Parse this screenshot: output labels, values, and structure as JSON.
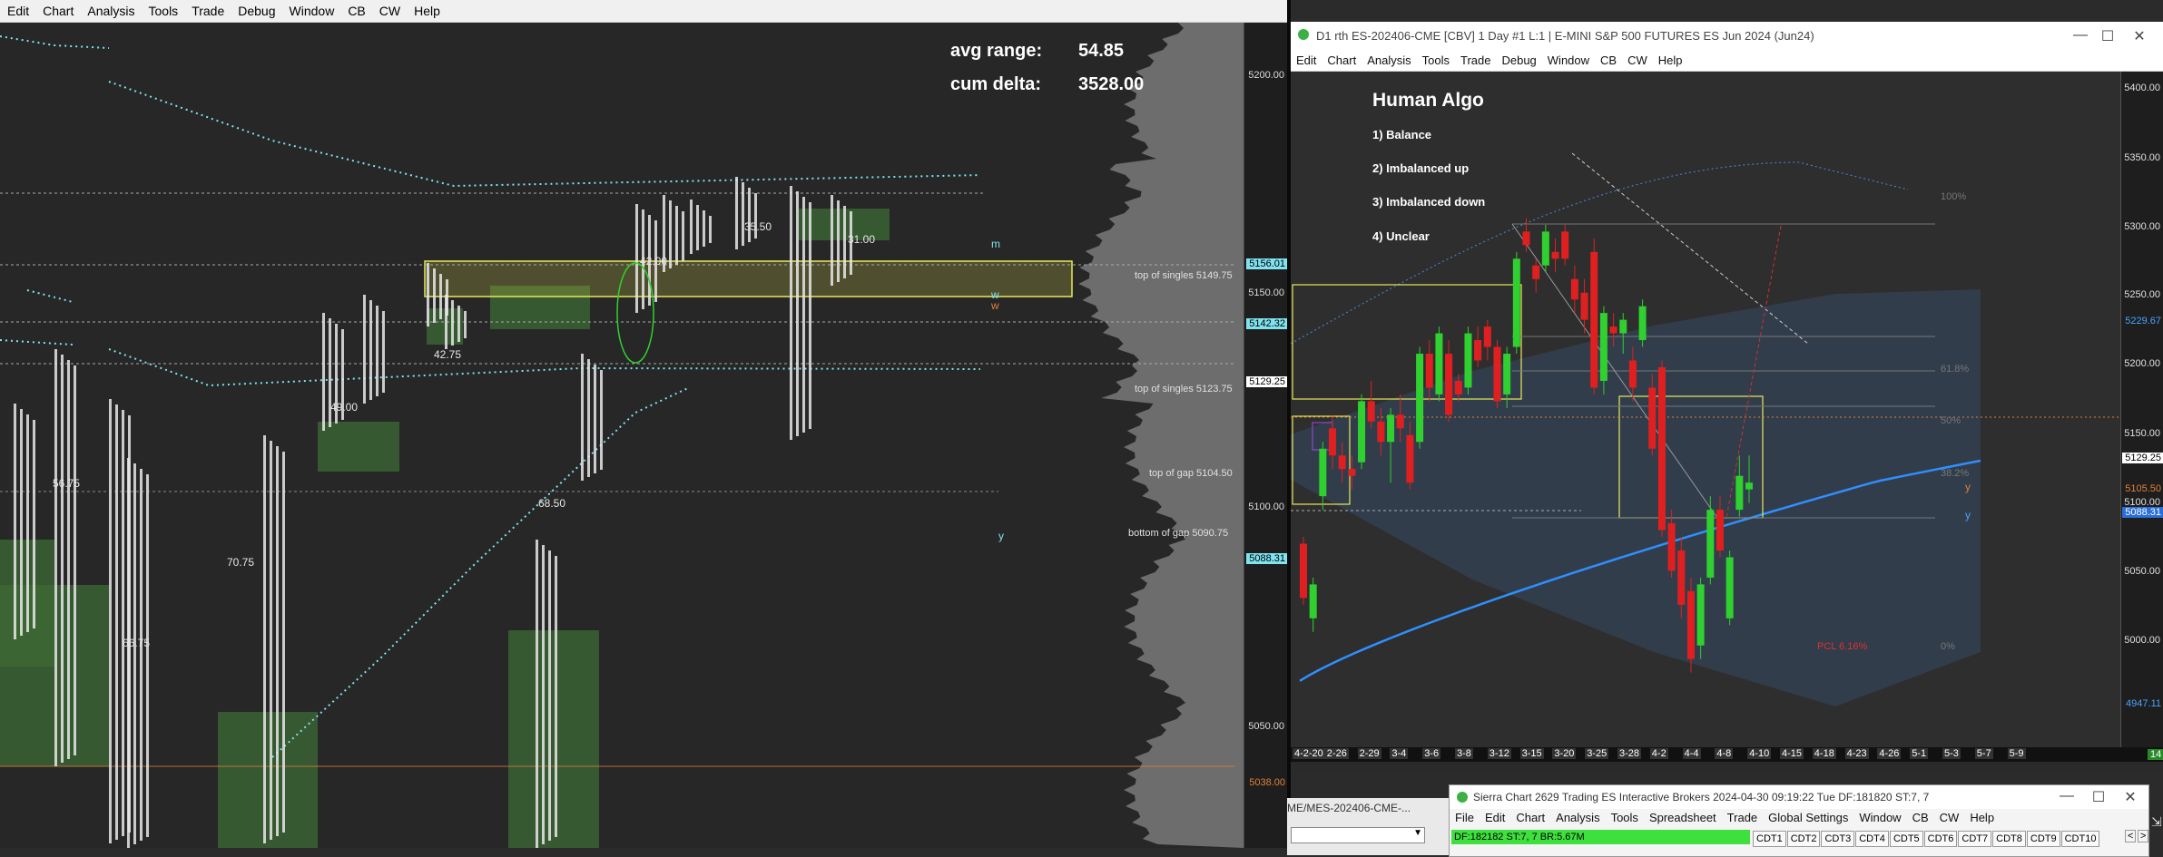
{
  "left_window": {
    "menu": [
      "Edit",
      "Chart",
      "Analysis",
      "Tools",
      "Trade",
      "Debug",
      "Window",
      "CB",
      "CW",
      "Help"
    ],
    "stats": {
      "avg_range_label": "avg range:",
      "avg_range_value": "54.85",
      "cum_delta_label": "cum delta:",
      "cum_delta_value": "3528.00"
    },
    "price_scale": [
      "5200.00",
      "5150.00",
      "5100.00",
      "5050.00"
    ],
    "price_boxes": [
      {
        "text": "5156.01",
        "color": "#7fe3f0"
      },
      {
        "text": "5142.32",
        "color": "#7fe3f0"
      },
      {
        "text": "5129.25",
        "color": "#ffffff"
      },
      {
        "text": "5088.31",
        "color": "#7fe3f0"
      },
      {
        "text": "5038.00",
        "color": "#e0803a"
      }
    ],
    "levels": [
      {
        "label": "top of singles  5149.75"
      },
      {
        "label": "top of singles  5123.75"
      },
      {
        "label": "top of gap  5104.50"
      },
      {
        "label": "bottom of gap  5090.75"
      }
    ],
    "range_labels": [
      "35.50",
      "31.00",
      "42.00",
      "42.75",
      "49.00",
      "56.75",
      "68.50",
      "70.75",
      "66.75"
    ],
    "band_letters": [
      "m",
      "w",
      "w",
      "y"
    ]
  },
  "right_window": {
    "title": "D1 rth ES-202406-CME [CBV]  1 Day  #1 L:1 | E-MINI S&P 500 FUTURES ES Jun 2024 (Jun24)",
    "menu": [
      "Edit",
      "Chart",
      "Analysis",
      "Tools",
      "Trade",
      "Debug",
      "Window",
      "CB",
      "CW",
      "Help"
    ],
    "algo": {
      "title": "Human Algo",
      "items": [
        "1)  Balance",
        "2)  Imbalanced up",
        "3)  Imbalanced down",
        "4)  Unclear"
      ]
    },
    "price_scale": [
      "5400.00",
      "5350.00",
      "5300.00",
      "5250.00",
      "5200.00",
      "5150.00",
      "5100.00",
      "5050.00",
      "5000.00"
    ],
    "price_boxes": [
      {
        "text": "5229.67",
        "color": "#4aa3ff"
      },
      {
        "text": "5129.25",
        "color": "#ffffff"
      },
      {
        "text": "5105.50",
        "color": "#e0803a"
      },
      {
        "text": "5088.31",
        "color": "#4aa3ff"
      },
      {
        "text": "4947.11",
        "color": "#4aa3ff"
      }
    ],
    "fib_labels": [
      "100%",
      "61.8%",
      "50%",
      "38.2%",
      "0%"
    ],
    "pct_label": "PCL 6.16%",
    "band_letters": [
      "y",
      "y"
    ],
    "dates": [
      "4-2-20",
      "2-26",
      "2-29",
      "3-4",
      "3-6",
      "3-8",
      "3-12",
      "3-15",
      "3-20",
      "3-25",
      "3-28",
      "4-2",
      "4-4",
      "4-8",
      "4-10",
      "4-15",
      "4-18",
      "4-23",
      "4-26",
      "5-1",
      "5-3",
      "5-7",
      "5-9"
    ],
    "corner_badge": "14",
    "chart_data": {
      "type": "candlestick",
      "title": "",
      "ylim": [
        4947,
        5420
      ],
      "candles": [
        {
          "o": 5085,
          "h": 5090,
          "l": 5040,
          "c": 5045
        },
        {
          "o": 5030,
          "h": 5060,
          "l": 5020,
          "c": 5055
        },
        {
          "o": 5120,
          "h": 5160,
          "l": 5110,
          "c": 5155
        },
        {
          "o": 5170,
          "h": 5180,
          "l": 5140,
          "c": 5150
        },
        {
          "o": 5150,
          "h": 5160,
          "l": 5130,
          "c": 5140
        },
        {
          "o": 5140,
          "h": 5150,
          "l": 5125,
          "c": 5135
        },
        {
          "o": 5145,
          "h": 5195,
          "l": 5140,
          "c": 5190
        },
        {
          "o": 5190,
          "h": 5205,
          "l": 5170,
          "c": 5175
        },
        {
          "o": 5175,
          "h": 5185,
          "l": 5150,
          "c": 5160
        },
        {
          "o": 5160,
          "h": 5185,
          "l": 5130,
          "c": 5180
        },
        {
          "o": 5180,
          "h": 5195,
          "l": 5160,
          "c": 5170
        },
        {
          "o": 5165,
          "h": 5175,
          "l": 5125,
          "c": 5130
        },
        {
          "o": 5160,
          "h": 5230,
          "l": 5155,
          "c": 5225
        },
        {
          "o": 5225,
          "h": 5235,
          "l": 5190,
          "c": 5200
        },
        {
          "o": 5195,
          "h": 5245,
          "l": 5190,
          "c": 5240
        },
        {
          "o": 5225,
          "h": 5235,
          "l": 5175,
          "c": 5180
        },
        {
          "o": 5205,
          "h": 5210,
          "l": 5190,
          "c": 5195
        },
        {
          "o": 5200,
          "h": 5245,
          "l": 5195,
          "c": 5240
        },
        {
          "o": 5235,
          "h": 5245,
          "l": 5215,
          "c": 5220
        },
        {
          "o": 5245,
          "h": 5250,
          "l": 5220,
          "c": 5230
        },
        {
          "o": 5230,
          "h": 5235,
          "l": 5185,
          "c": 5190
        },
        {
          "o": 5195,
          "h": 5230,
          "l": 5185,
          "c": 5225
        },
        {
          "o": 5230,
          "h": 5300,
          "l": 5225,
          "c": 5295
        },
        {
          "o": 5315,
          "h": 5325,
          "l": 5300,
          "c": 5305
        },
        {
          "o": 5290,
          "h": 5295,
          "l": 5270,
          "c": 5280
        },
        {
          "o": 5290,
          "h": 5320,
          "l": 5285,
          "c": 5315
        },
        {
          "o": 5300,
          "h": 5310,
          "l": 5285,
          "c": 5295
        },
        {
          "o": 5315,
          "h": 5320,
          "l": 5290,
          "c": 5295
        },
        {
          "o": 5280,
          "h": 5290,
          "l": 5255,
          "c": 5265
        },
        {
          "o": 5270,
          "h": 5280,
          "l": 5240,
          "c": 5250
        },
        {
          "o": 5300,
          "h": 5310,
          "l": 5195,
          "c": 5200
        },
        {
          "o": 5205,
          "h": 5260,
          "l": 5195,
          "c": 5255
        },
        {
          "o": 5245,
          "h": 5255,
          "l": 5230,
          "c": 5240
        },
        {
          "o": 5240,
          "h": 5255,
          "l": 5225,
          "c": 5250
        },
        {
          "o": 5220,
          "h": 5230,
          "l": 5190,
          "c": 5200
        },
        {
          "o": 5235,
          "h": 5265,
          "l": 5230,
          "c": 5260
        },
        {
          "o": 5200,
          "h": 5210,
          "l": 5150,
          "c": 5155
        },
        {
          "o": 5215,
          "h": 5220,
          "l": 5090,
          "c": 5095
        },
        {
          "o": 5100,
          "h": 5110,
          "l": 5060,
          "c": 5065
        },
        {
          "o": 5080,
          "h": 5090,
          "l": 5030,
          "c": 5040
        },
        {
          "o": 5050,
          "h": 5060,
          "l": 4990,
          "c": 5000
        },
        {
          "o": 5010,
          "h": 5060,
          "l": 5000,
          "c": 5055
        },
        {
          "o": 5060,
          "h": 5120,
          "l": 5055,
          "c": 5110
        },
        {
          "o": 5110,
          "h": 5120,
          "l": 5075,
          "c": 5080
        },
        {
          "o": 5030,
          "h": 5080,
          "l": 5025,
          "c": 5075
        },
        {
          "o": 5110,
          "h": 5150,
          "l": 5105,
          "c": 5135
        },
        {
          "o": 5125,
          "h": 5150,
          "l": 5115,
          "c": 5130
        }
      ]
    }
  },
  "bottom_window": {
    "title": "Sierra Chart 2629 Trading ES Interactive Brokers 2024-04-30  09:19:22 Tue DF:181820  ST:7, 7",
    "menu": [
      "File",
      "Edit",
      "Chart",
      "Analysis",
      "Tools",
      "Spreadsheet",
      "Trade",
      "Global Settings",
      "Window",
      "CB",
      "CW",
      "Help"
    ],
    "status": "DF:182182  ST:7, 7   BR:5.67M",
    "tabs": [
      "CDT1",
      "CDT2",
      "CDT3",
      "CDT4",
      "CDT5",
      "CDT6",
      "CDT7",
      "CDT8",
      "CDT9",
      "CDT10"
    ],
    "fragment_text": "ME/MES-202406-CME-..."
  }
}
